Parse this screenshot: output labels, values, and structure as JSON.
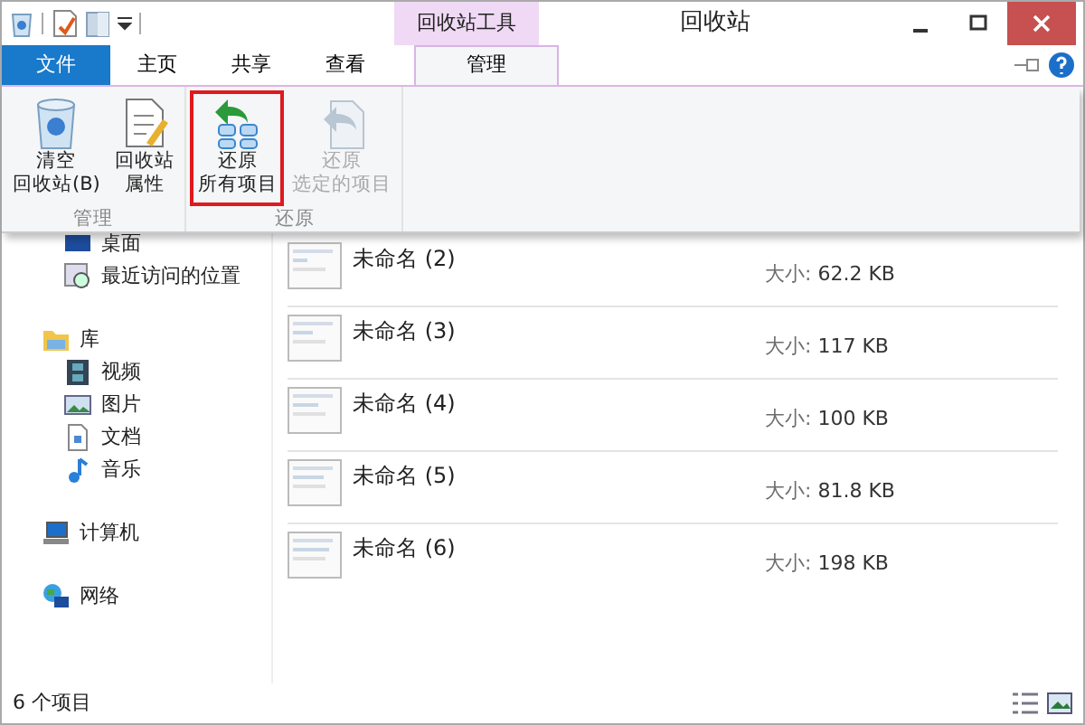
{
  "window": {
    "title": "回收站",
    "context_group": "回收站工具"
  },
  "tabs": [
    {
      "label": "文件",
      "kind": "file",
      "selected": false
    },
    {
      "label": "主页",
      "kind": "tab",
      "selected": false
    },
    {
      "label": "共享",
      "kind": "tab",
      "selected": false
    },
    {
      "label": "查看",
      "kind": "tab",
      "selected": false
    },
    {
      "label": "管理",
      "kind": "context",
      "selected": true
    }
  ],
  "ribbon_groups": [
    {
      "label": "管理",
      "buttons": [
        {
          "lines": [
            "清空",
            "回收站(B)"
          ],
          "disabled": false,
          "highlighted": false
        },
        {
          "lines": [
            "回收站",
            "属性"
          ],
          "disabled": false,
          "highlighted": false
        }
      ]
    },
    {
      "label": "还原",
      "buttons": [
        {
          "lines": [
            "还原",
            "所有项目"
          ],
          "disabled": false,
          "highlighted": true
        },
        {
          "lines": [
            "还原",
            "选定的项目"
          ],
          "disabled": true,
          "highlighted": false
        }
      ]
    }
  ],
  "sidebar": {
    "items": [
      {
        "children": [
          {
            "label": "桌面"
          },
          {
            "label": "最近访问的位置"
          }
        ]
      },
      {
        "label": "库",
        "children": [
          {
            "label": "视频"
          },
          {
            "label": "图片"
          },
          {
            "label": "文档"
          },
          {
            "label": "音乐"
          }
        ]
      },
      {
        "label": "计算机"
      },
      {
        "label": "网络"
      }
    ]
  },
  "files": [
    {
      "name": "未命名 (2)",
      "size_label": "大小:",
      "size": "62.2 KB"
    },
    {
      "name": "未命名 (3)",
      "size_label": "大小:",
      "size": "117 KB"
    },
    {
      "name": "未命名 (4)",
      "size_label": "大小:",
      "size": "100 KB"
    },
    {
      "name": "未命名 (5)",
      "size_label": "大小:",
      "size": "81.8 KB"
    },
    {
      "name": "未命名 (6)",
      "size_label": "大小:",
      "size": "198 KB"
    }
  ],
  "status_bar": {
    "text": "6 个项目"
  }
}
